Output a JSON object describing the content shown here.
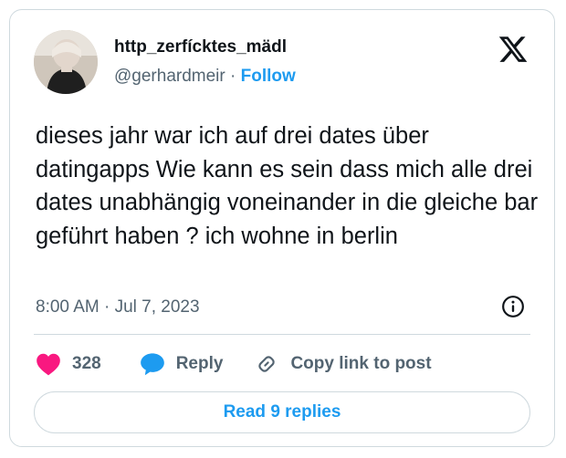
{
  "author": {
    "display_name": "http_zerfícktes_mädl",
    "handle": "@gerhardmeir",
    "separator": "·",
    "follow_label": "Follow"
  },
  "tweet": {
    "text": "dieses jahr war ich auf drei dates über datingapps Wie kann es sein dass mich alle drei dates unabhängig voneinander in die gleiche bar geführt haben ? ich wohne in berlin",
    "timestamp": "8:00 AM · Jul 7, 2023"
  },
  "actions": {
    "like_count": "328",
    "reply_label": "Reply",
    "copy_label": "Copy link to post"
  },
  "read_replies_label": "Read 9 replies",
  "colors": {
    "accent": "#1d9bf0",
    "like": "#f91880",
    "text": "#0f1419",
    "muted": "#536471",
    "border": "#cfd9de"
  },
  "icons": [
    "avatar",
    "x-logo-icon",
    "info-icon",
    "heart-icon",
    "reply-bubble-icon",
    "link-icon"
  ]
}
